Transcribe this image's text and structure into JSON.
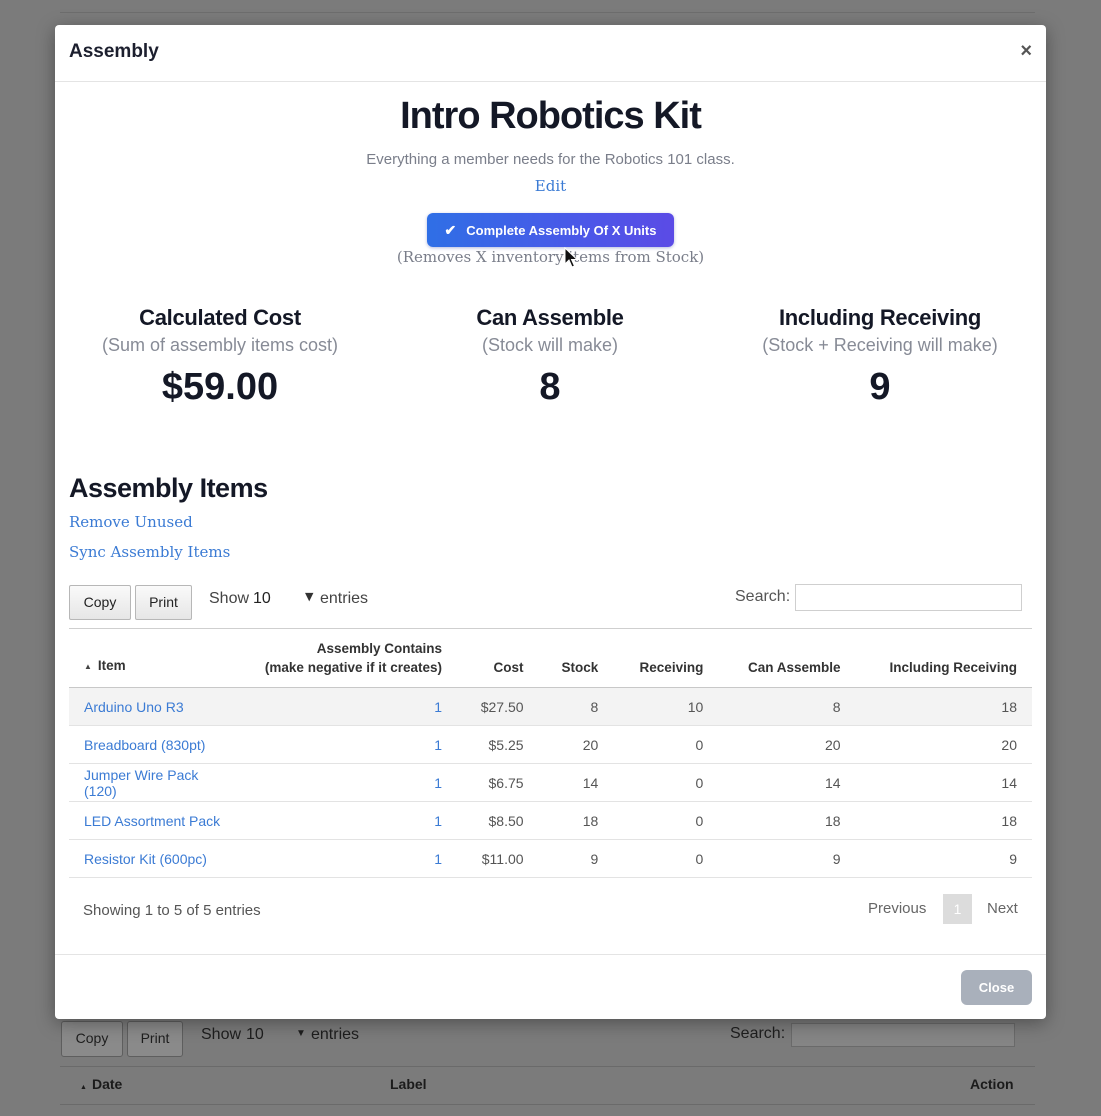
{
  "background": {
    "copy_label": "Copy",
    "print_label": "Print",
    "show_label": "Show",
    "show_value": "10",
    "entries_label": "entries",
    "search_label": "Search:",
    "columns": [
      "Date",
      "Label",
      "Action"
    ]
  },
  "modal": {
    "title": "Assembly",
    "close_x": "×",
    "kit_title": "Intro Robotics Kit",
    "kit_description": "Everything a member needs for the Robotics 101 class.",
    "edit_label": "Edit",
    "complete_button": "Complete Assembly Of X Units",
    "complete_note": "(Removes X inventory items from Stock)",
    "stats": [
      {
        "title": "Calculated Cost",
        "subtitle": "(Sum of assembly items cost)",
        "value": "$59.00"
      },
      {
        "title": "Can Assemble",
        "subtitle": "(Stock will make)",
        "value": "8"
      },
      {
        "title": "Including Receiving",
        "subtitle": "(Stock + Receiving will make)",
        "value": "9"
      }
    ],
    "section_title": "Assembly Items",
    "remove_unused": "Remove Unused",
    "sync_items": "Sync Assembly Items",
    "table_controls": {
      "copy_label": "Copy",
      "print_label": "Print",
      "show_label": "Show",
      "show_value": "10",
      "entries_label": "entries",
      "search_label": "Search:",
      "search_value": ""
    },
    "columns": {
      "item": "Item",
      "contains_line1": "Assembly Contains",
      "contains_line2": "(make negative if it creates)",
      "cost": "Cost",
      "stock": "Stock",
      "receiving": "Receiving",
      "can_assemble": "Can Assemble",
      "including_receiving": "Including Receiving"
    },
    "rows": [
      {
        "item": "Arduino Uno R3",
        "contains": "1",
        "cost": "$27.50",
        "stock": "8",
        "receiving": "10",
        "can_assemble": "8",
        "including_receiving": "18"
      },
      {
        "item": "Breadboard (830pt)",
        "contains": "1",
        "cost": "$5.25",
        "stock": "20",
        "receiving": "0",
        "can_assemble": "20",
        "including_receiving": "20"
      },
      {
        "item": "Jumper Wire Pack (120)",
        "contains": "1",
        "cost": "$6.75",
        "stock": "14",
        "receiving": "0",
        "can_assemble": "14",
        "including_receiving": "14"
      },
      {
        "item": "LED Assortment Pack",
        "contains": "1",
        "cost": "$8.50",
        "stock": "18",
        "receiving": "0",
        "can_assemble": "18",
        "including_receiving": "18"
      },
      {
        "item": "Resistor Kit (600pc)",
        "contains": "1",
        "cost": "$11.00",
        "stock": "9",
        "receiving": "0",
        "can_assemble": "9",
        "including_receiving": "9"
      }
    ],
    "showing_text": "Showing 1 to 5 of 5 entries",
    "pagination": {
      "previous": "Previous",
      "current": "1",
      "next": "Next"
    },
    "footer_close": "Close"
  },
  "colors": {
    "accent_blue": "#3b7bd4",
    "primary_gradient_start": "#2f6fe6",
    "primary_gradient_end": "#5b4be6",
    "close_button": "#a9b0bb"
  }
}
